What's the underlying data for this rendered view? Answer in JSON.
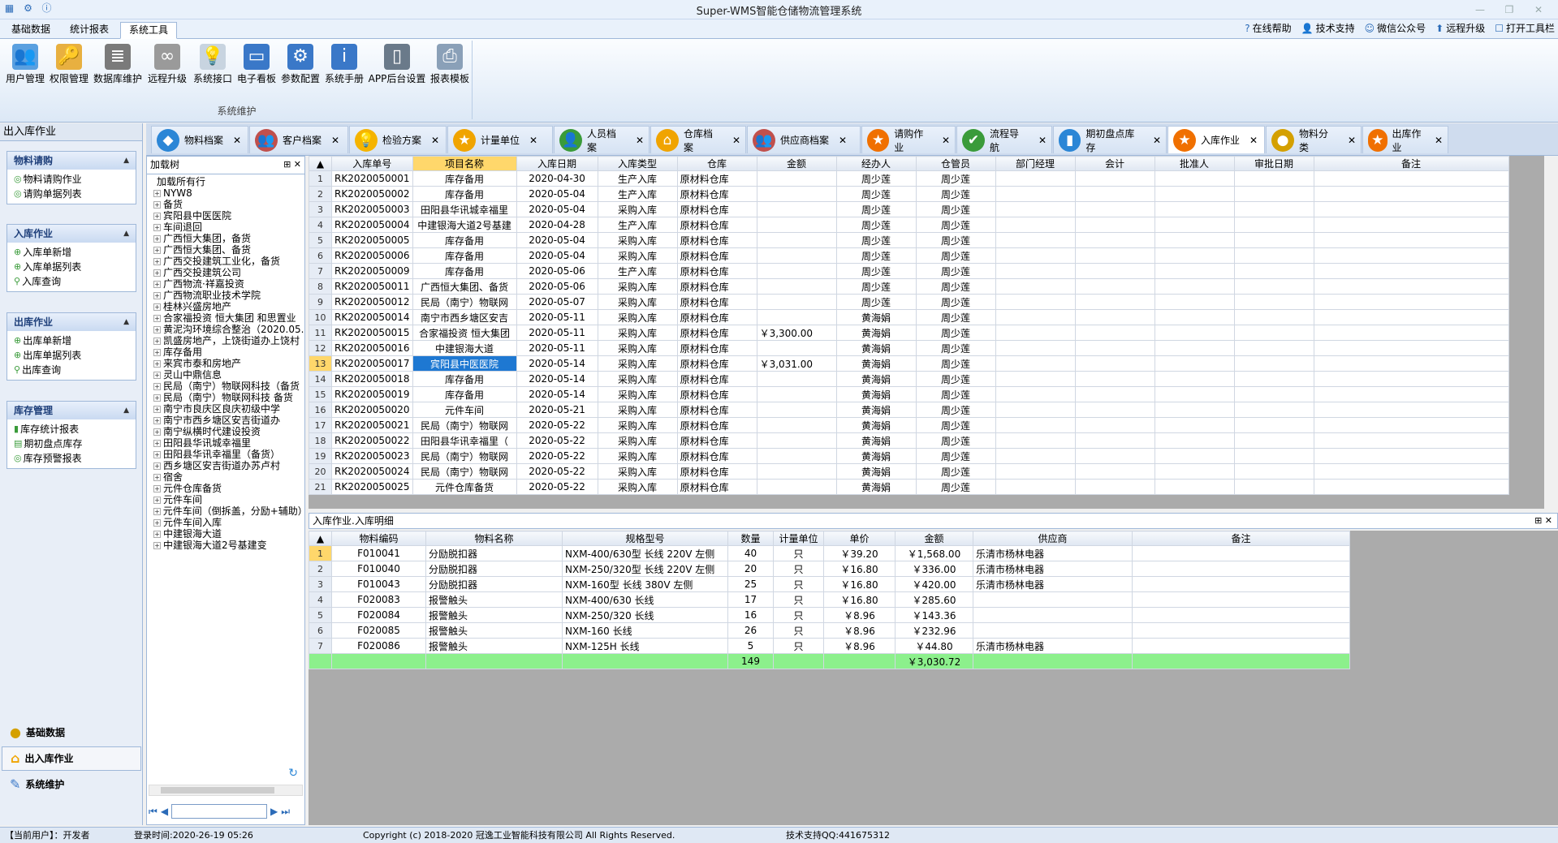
{
  "window_title": "Super-WMS智能仓储物流管理系统",
  "menu_tabs": [
    "基础数据",
    "统计报表",
    "系统工具"
  ],
  "help_links": [
    "在线帮助",
    "技术支持",
    "微信公众号",
    "远程升级",
    "打开工具栏"
  ],
  "ribbon": {
    "group_label": "系统维护",
    "buttons": [
      "用户管理",
      "权限管理",
      "数据库维护",
      "远程升级",
      "系统接口",
      "电子看板",
      "参数配置",
      "系统手册",
      "APP后台设置",
      "报表模板"
    ]
  },
  "left_panel": {
    "title": "出入库作业",
    "sections": [
      {
        "title": "物料请购",
        "items": [
          "物料请购作业",
          "请购单据列表"
        ]
      },
      {
        "title": "入库作业",
        "items": [
          "入库单新增",
          "入库单据列表",
          "入库查询"
        ]
      },
      {
        "title": "出库作业",
        "items": [
          "出库单新增",
          "出库单据列表",
          "出库查询"
        ]
      },
      {
        "title": "库存管理",
        "items": [
          "库存统计报表",
          "期初盘点库存",
          "库存预警报表"
        ]
      }
    ],
    "nav": [
      "基础数据",
      "出入库作业",
      "系统维护"
    ]
  },
  "tree": {
    "title": "加载树",
    "root": "加载所有行",
    "nodes": [
      "NYW8",
      "备货",
      "宾阳县中医医院",
      "车间退回",
      "广西恒大集团，备货",
      "广西恒大集团、备货",
      "广西交投建筑工业化，备货",
      "广西交投建筑公司",
      "广西物流·祥嘉投资",
      "广西物流职业技术学院",
      "桂林兴盛房地产",
      "合家福投资 恒大集团 和思置业",
      "黄泥沟环境综合整治（2020.05.",
      "凯盛房地产，上饶街道办上饶村",
      "库存备用",
      "来宾市泰和房地产",
      "灵山中鼎信息",
      "民局（南宁）物联网科技（备货",
      "民局（南宁）物联网科技 备货",
      "南宁市良庆区良庆初级中学",
      "南宁市西乡塘区安吉街道办",
      "南宁纵横时代建设投资",
      "田阳县华讯城幸福里",
      "田阳县华讯幸福里（备货）",
      "西乡塘区安吉街道办苏卢村",
      "宿舍",
      "元件仓库备货",
      "元件车间",
      "元件车间（倒拆盖，分励+辅助）",
      "元件车间入库",
      "中建银海大道",
      "中建银海大道2号基建变"
    ]
  },
  "doc_tabs": [
    {
      "label": "物料档案",
      "icon": "cube-icon",
      "color": "#2b86d6"
    },
    {
      "label": "客户档案",
      "icon": "user-group-icon",
      "color": "#c0504d"
    },
    {
      "label": "检验方案",
      "icon": "bulb-icon",
      "color": "#f5b400"
    },
    {
      "label": "计量单位",
      "icon": "star-icon",
      "color": "#f0a400"
    },
    {
      "label": "人员档案",
      "icon": "person-icon",
      "color": "#3a9b3a"
    },
    {
      "label": "仓库档案",
      "icon": "house-icon",
      "color": "#f0a400"
    },
    {
      "label": "供应商档案",
      "icon": "user-group-icon",
      "color": "#c0504d"
    },
    {
      "label": "请购作业",
      "icon": "star-icon",
      "color": "#f07000"
    },
    {
      "label": "流程导航",
      "icon": "check-shield-icon",
      "color": "#3a9b3a"
    },
    {
      "label": "期初盘点库存",
      "icon": "bottle-icon",
      "color": "#2b86d6"
    },
    {
      "label": "入库作业",
      "icon": "star-icon",
      "color": "#f07000"
    },
    {
      "label": "物料分类",
      "icon": "medal-icon",
      "color": "#d4a000"
    },
    {
      "label": "出库作业",
      "icon": "star-icon",
      "color": "#f07000"
    }
  ],
  "main_grid": {
    "columns": [
      "入库单号",
      "项目名称",
      "入库日期",
      "入库类型",
      "仓库",
      "金额",
      "经办人",
      "仓管员",
      "部门经理",
      "会计",
      "批准人",
      "审批日期",
      "备注"
    ],
    "rows": [
      [
        "RK2020050001",
        "库存备用",
        "2020-04-30",
        "生产入库",
        "原材料仓库",
        "",
        "周少莲",
        "周少莲"
      ],
      [
        "RK2020050002",
        "库存备用",
        "2020-05-04",
        "生产入库",
        "原材料仓库",
        "",
        "周少莲",
        "周少莲"
      ],
      [
        "RK2020050003",
        "田阳县华讯城幸福里",
        "2020-05-04",
        "采购入库",
        "原材料仓库",
        "",
        "周少莲",
        "周少莲"
      ],
      [
        "RK2020050004",
        "中建银海大道2号基建",
        "2020-04-28",
        "生产入库",
        "原材料仓库",
        "",
        "周少莲",
        "周少莲"
      ],
      [
        "RK2020050005",
        "库存备用",
        "2020-05-04",
        "采购入库",
        "原材料仓库",
        "",
        "周少莲",
        "周少莲"
      ],
      [
        "RK2020050006",
        "库存备用",
        "2020-05-04",
        "采购入库",
        "原材料仓库",
        "",
        "周少莲",
        "周少莲"
      ],
      [
        "RK2020050009",
        "库存备用",
        "2020-05-06",
        "生产入库",
        "原材料仓库",
        "",
        "周少莲",
        "周少莲"
      ],
      [
        "RK2020050011",
        "广西恒大集团、备货",
        "2020-05-06",
        "采购入库",
        "原材料仓库",
        "",
        "周少莲",
        "周少莲"
      ],
      [
        "RK2020050012",
        "民局（南宁）物联网",
        "2020-05-07",
        "采购入库",
        "原材料仓库",
        "",
        "周少莲",
        "周少莲"
      ],
      [
        "RK2020050014",
        "南宁市西乡塘区安吉",
        "2020-05-11",
        "采购入库",
        "原材料仓库",
        "",
        "黄海娟",
        "周少莲"
      ],
      [
        "RK2020050015",
        "合家福投资 恒大集团",
        "2020-05-11",
        "采购入库",
        "原材料仓库",
        "￥3,300.00",
        "黄海娟",
        "周少莲"
      ],
      [
        "RK2020050016",
        "中建银海大道",
        "2020-05-11",
        "采购入库",
        "原材料仓库",
        "",
        "黄海娟",
        "周少莲"
      ],
      [
        "RK2020050017",
        "宾阳县中医医院",
        "2020-05-14",
        "采购入库",
        "原材料仓库",
        "￥3,031.00",
        "黄海娟",
        "周少莲"
      ],
      [
        "RK2020050018",
        "库存备用",
        "2020-05-14",
        "采购入库",
        "原材料仓库",
        "",
        "黄海娟",
        "周少莲"
      ],
      [
        "RK2020050019",
        "库存备用",
        "2020-05-14",
        "采购入库",
        "原材料仓库",
        "",
        "黄海娟",
        "周少莲"
      ],
      [
        "RK2020050020",
        "元件车间",
        "2020-05-21",
        "采购入库",
        "原材料仓库",
        "",
        "黄海娟",
        "周少莲"
      ],
      [
        "RK2020050021",
        "民局（南宁）物联网",
        "2020-05-22",
        "采购入库",
        "原材料仓库",
        "",
        "黄海娟",
        "周少莲"
      ],
      [
        "RK2020050022",
        "田阳县华讯幸福里（",
        "2020-05-22",
        "采购入库",
        "原材料仓库",
        "",
        "黄海娟",
        "周少莲"
      ],
      [
        "RK2020050023",
        "民局（南宁）物联网",
        "2020-05-22",
        "采购入库",
        "原材料仓库",
        "",
        "黄海娟",
        "周少莲"
      ],
      [
        "RK2020050024",
        "民局（南宁）物联网",
        "2020-05-22",
        "采购入库",
        "原材料仓库",
        "",
        "黄海娟",
        "周少莲"
      ],
      [
        "RK2020050025",
        "元件仓库备货",
        "2020-05-22",
        "采购入库",
        "原材料仓库",
        "",
        "黄海娟",
        "周少莲"
      ]
    ],
    "selected_row": 13
  },
  "detail": {
    "title": "入库作业.入库明细",
    "columns": [
      "物料编码",
      "物料名称",
      "规格型号",
      "数量",
      "计量单位",
      "单价",
      "金额",
      "供应商",
      "备注"
    ],
    "rows": [
      [
        "F010041",
        "分励脱扣器",
        "NXM-400/630型 长线 220V 左侧",
        "40",
        "只",
        "￥39.20",
        "￥1,568.00",
        "乐清市杨林电器",
        ""
      ],
      [
        "F010040",
        "分励脱扣器",
        "NXM-250/320型 长线 220V 左侧",
        "20",
        "只",
        "￥16.80",
        "￥336.00",
        "乐清市杨林电器",
        ""
      ],
      [
        "F010043",
        "分励脱扣器",
        "NXM-160型 长线 380V 左侧",
        "25",
        "只",
        "￥16.80",
        "￥420.00",
        "乐清市杨林电器",
        ""
      ],
      [
        "F020083",
        "报警触头",
        "NXM-400/630 长线",
        "17",
        "只",
        "￥16.80",
        "￥285.60",
        "",
        ""
      ],
      [
        "F020084",
        "报警触头",
        "NXM-250/320 长线",
        "16",
        "只",
        "￥8.96",
        "￥143.36",
        "",
        ""
      ],
      [
        "F020085",
        "报警触头",
        "NXM-160 长线",
        "26",
        "只",
        "￥8.96",
        "￥232.96",
        "",
        ""
      ],
      [
        "F020086",
        "报警触头",
        "NXM-125H 长线",
        "5",
        "只",
        "￥8.96",
        "￥44.80",
        "乐清市杨林电器",
        ""
      ]
    ],
    "sum_qty": "149",
    "sum_amount": "￥3,030.72"
  },
  "status": {
    "user_label": "【当前用户】：开发者",
    "login_time": "登录时间:2020-26-19 05:26",
    "copyright": "Copyright (c) 2018-2020 冠逸工业智能科技有限公司 All Rights Reserved.",
    "support": "技术支持QQ:441675312"
  }
}
